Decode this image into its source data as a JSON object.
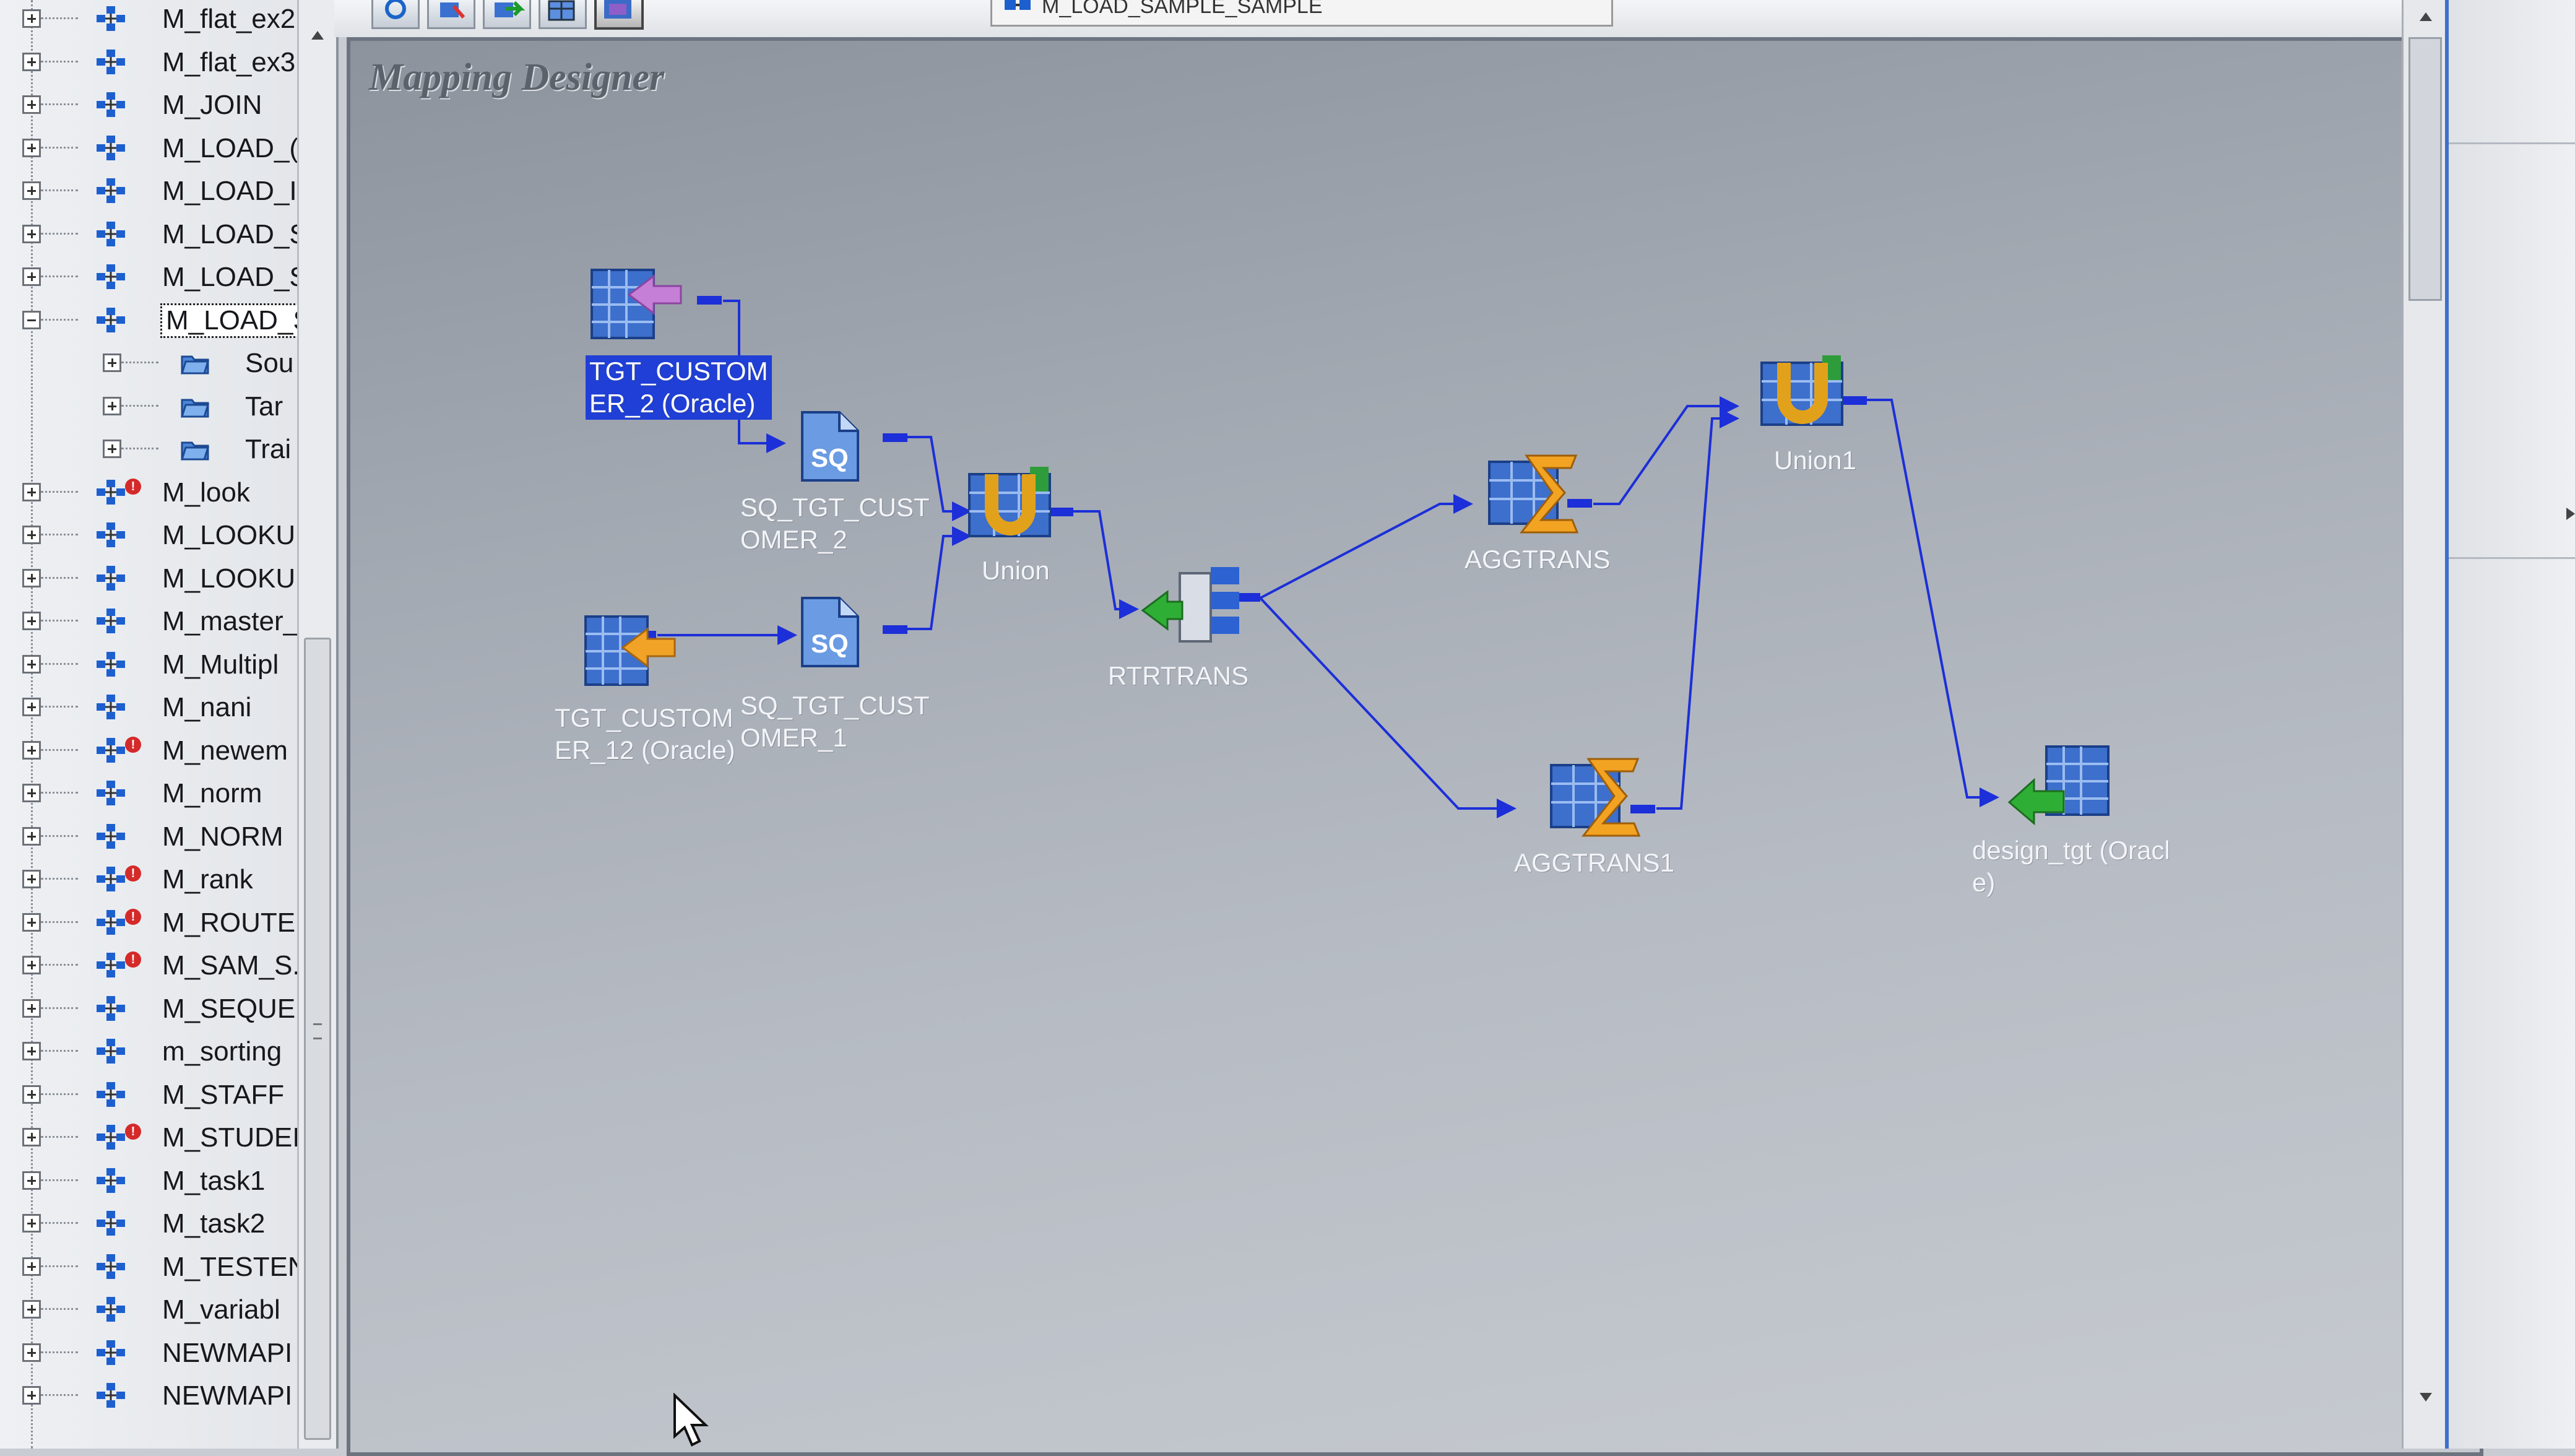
{
  "navigator": {
    "items": [
      {
        "label": "M_flat_ex2",
        "expander": "plus",
        "error": false
      },
      {
        "label": "M_flat_ex3",
        "expander": "plus",
        "error": false
      },
      {
        "label": "M_JOIN",
        "expander": "plus",
        "error": false
      },
      {
        "label": "M_LOAD_(",
        "expander": "plus",
        "error": false
      },
      {
        "label": "M_LOAD_I",
        "expander": "plus",
        "error": false
      },
      {
        "label": "M_LOAD_S",
        "expander": "plus",
        "error": false
      },
      {
        "label": "M_LOAD_S",
        "expander": "plus",
        "error": false
      },
      {
        "label": "M_LOAD_S",
        "expander": "minus",
        "error": false,
        "selected": true,
        "children": [
          {
            "label": "Sou",
            "kind": "folder"
          },
          {
            "label": "Tar",
            "kind": "folder"
          },
          {
            "label": "Trai",
            "kind": "folder"
          }
        ]
      },
      {
        "label": "M_look",
        "expander": "plus",
        "error": true
      },
      {
        "label": "M_LOOKU",
        "expander": "plus",
        "error": false
      },
      {
        "label": "M_LOOKU",
        "expander": "plus",
        "error": false
      },
      {
        "label": "M_master_",
        "expander": "plus",
        "error": false
      },
      {
        "label": "M_Multipl",
        "expander": "plus",
        "error": false
      },
      {
        "label": "M_nani",
        "expander": "plus",
        "error": false
      },
      {
        "label": "M_newem",
        "expander": "plus",
        "error": true
      },
      {
        "label": "M_norm",
        "expander": "plus",
        "error": false
      },
      {
        "label": "M_NORM",
        "expander": "plus",
        "error": false
      },
      {
        "label": "M_rank",
        "expander": "plus",
        "error": true
      },
      {
        "label": "M_ROUTE",
        "expander": "plus",
        "error": true
      },
      {
        "label": "M_SAM_S.",
        "expander": "plus",
        "error": true
      },
      {
        "label": "M_SEQUEI",
        "expander": "plus",
        "error": false
      },
      {
        "label": "m_sorting",
        "expander": "plus",
        "error": false
      },
      {
        "label": "M_STAFF",
        "expander": "plus",
        "error": false
      },
      {
        "label": "M_STUDEI",
        "expander": "plus",
        "error": true
      },
      {
        "label": "M_task1",
        "expander": "plus",
        "error": false
      },
      {
        "label": "M_task2",
        "expander": "plus",
        "error": false
      },
      {
        "label": "M_TESTEN",
        "expander": "plus",
        "error": false
      },
      {
        "label": "M_variabl",
        "expander": "plus",
        "error": false
      },
      {
        "label": "NEWMAPI",
        "expander": "plus",
        "error": false
      },
      {
        "label": "NEWMAPI",
        "expander": "plus",
        "error": false
      }
    ]
  },
  "toolbar": {
    "tab_label": "M_LOAD_SAMPLE_SAMPLE"
  },
  "workspace": {
    "title": "Mapping Designer",
    "nodes": {
      "tgt_customer_2": {
        "label": "TGT_CUSTOM\nER_2 (Oracle)",
        "icon": "source-definition-icon"
      },
      "tgt_customer_12": {
        "label": "TGT_CUSTOM\nER_12 (Oracle)",
        "icon": "source-definition-icon"
      },
      "sq_tgt_customer_2": {
        "label": "SQ_TGT_CUST\nOMER_2",
        "icon": "source-qualifier-icon"
      },
      "sq_tgt_customer_1": {
        "label": "SQ_TGT_CUST\nOMER_1",
        "icon": "source-qualifier-icon"
      },
      "union": {
        "label": "Union",
        "icon": "union-icon"
      },
      "rtrtrans": {
        "label": "RTRTRANS",
        "icon": "router-icon"
      },
      "aggtrans": {
        "label": "AGGTRANS",
        "icon": "aggregator-icon"
      },
      "aggtrans1": {
        "label": "AGGTRANS1",
        "icon": "aggregator-icon"
      },
      "union1": {
        "label": "Union1",
        "icon": "union-icon"
      },
      "design_tgt": {
        "label": "design_tgt (Oracl\ne)",
        "icon": "target-definition-icon"
      }
    }
  },
  "colors": {
    "link": "#1c2fd8",
    "selection": "#1f3fd6",
    "workspace_bg": "#a3a9b2"
  }
}
